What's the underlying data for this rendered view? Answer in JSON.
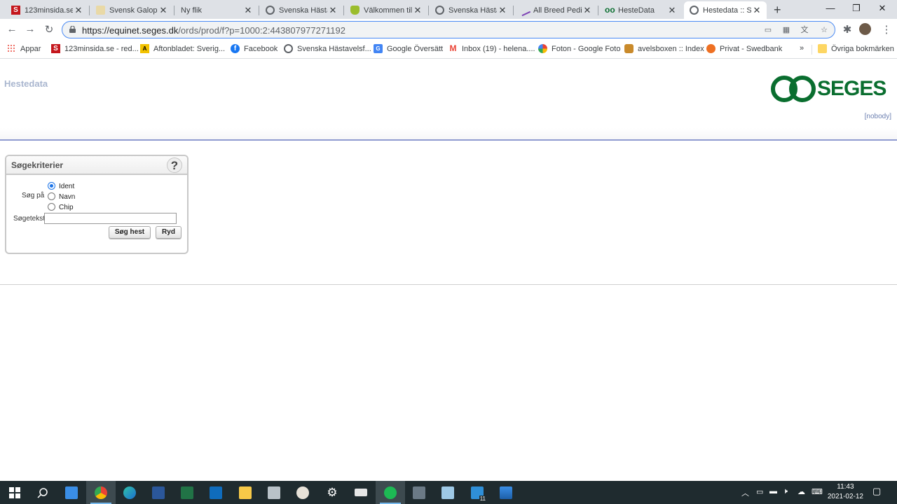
{
  "tabs": [
    {
      "title": "123minsida.se",
      "icon": "s-red-icon"
    },
    {
      "title": "Svensk Galopp",
      "icon": "galopp-icon"
    },
    {
      "title": "Ny flik",
      "icon": ""
    },
    {
      "title": "Svenska Hästav",
      "icon": "globe-icon"
    },
    {
      "title": "Välkommen till",
      "icon": "shield-icon"
    },
    {
      "title": "Svenska Hästav",
      "icon": "globe-icon"
    },
    {
      "title": "All Breed Pedig",
      "icon": "pedigree-icon"
    },
    {
      "title": "HesteData",
      "icon": "infinity-icon"
    },
    {
      "title": "Hestedata :: Sø",
      "icon": "globe-icon",
      "active": true
    }
  ],
  "address": {
    "host": "https://equinet.seges.dk",
    "path": "/ords/prod/f?p=1000:2:443807977271192"
  },
  "bookmarks": [
    {
      "label": "Appar",
      "icon": "apps-grid-icon"
    },
    {
      "label": "123minsida.se - red...",
      "icon": "s-red-icon"
    },
    {
      "label": "Aftonbladet: Sverig...",
      "icon": "aftonbladet-icon"
    },
    {
      "label": "Facebook",
      "icon": "facebook-icon"
    },
    {
      "label": "Svenska Hästavelsf...",
      "icon": "globe-icon"
    },
    {
      "label": "Google Översätt",
      "icon": "translate-icon"
    },
    {
      "label": "Inbox (19) - helena....",
      "icon": "gmail-icon"
    },
    {
      "label": "Foton - Google Foto",
      "icon": "photos-icon"
    },
    {
      "label": "avelsboxen :: Index",
      "icon": "avelsboxen-icon"
    },
    {
      "label": "Privat - Swedbank",
      "icon": "swedbank-icon"
    }
  ],
  "bookmarks_more": "»",
  "bookmarks_other": "Övriga bokmärken",
  "page": {
    "app_title": "Hestedata",
    "logo_text": "SEGES",
    "user": "[nobody]"
  },
  "search": {
    "title": "Søgekriterier",
    "help": "?",
    "search_on_label": "Søg på",
    "options": [
      "Ident",
      "Navn",
      "Chip"
    ],
    "selected": "Ident",
    "text_label": "Søgetekst",
    "text_value": "",
    "search_button": "Søg hest",
    "clear_button": "Ryd"
  },
  "taskbar": {
    "time": "11:43",
    "date": "2021-02-12",
    "notification_badge": "11"
  }
}
